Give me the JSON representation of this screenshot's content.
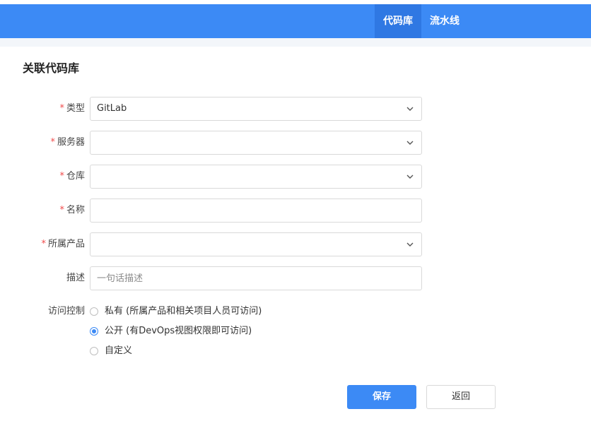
{
  "nav": {
    "tabs": [
      {
        "label": "代码库",
        "active": true
      },
      {
        "label": "流水线",
        "active": false
      }
    ],
    "accent_color": "#3c8af5"
  },
  "page": {
    "title": "关联代码库"
  },
  "form": {
    "type": {
      "label": "类型",
      "required": true,
      "value": "GitLab"
    },
    "server": {
      "label": "服务器",
      "required": true,
      "value": ""
    },
    "repository": {
      "label": "仓库",
      "required": true,
      "value": ""
    },
    "name": {
      "label": "名称",
      "required": true,
      "value": ""
    },
    "product": {
      "label": "所属产品",
      "required": true,
      "value": ""
    },
    "description": {
      "label": "描述",
      "required": false,
      "placeholder": "一句话描述",
      "value": ""
    },
    "access": {
      "label": "访问控制",
      "options": [
        {
          "label": "私有 (所属产品和相关项目人员可访问)",
          "checked": false
        },
        {
          "label": "公开 (有DevOps视图权限即可访问)",
          "checked": true
        },
        {
          "label": "自定义",
          "checked": false
        }
      ]
    },
    "required_mark": "*"
  },
  "actions": {
    "save_label": "保存",
    "back_label": "返回"
  }
}
